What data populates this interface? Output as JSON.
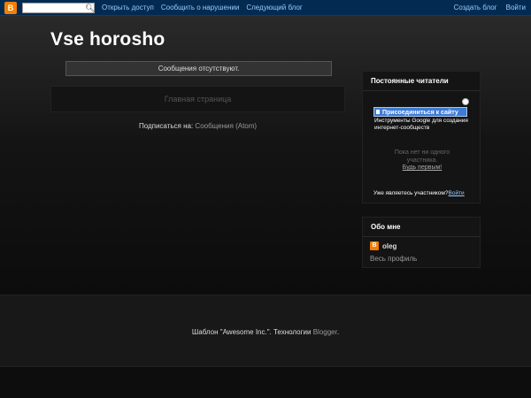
{
  "navbar": {
    "logo_letter": "B",
    "search_placeholder": "",
    "links": [
      "Открыть доступ",
      "Сообщить о нарушении",
      "Следующий блог"
    ],
    "right_links": [
      "Создать блог",
      "Войти"
    ]
  },
  "blog": {
    "title": "Vse horosho",
    "no_posts": "Сообщения отсутствуют.",
    "home_link": "Главная страница",
    "subscribe_prefix": "Подписаться на:",
    "subscribe_link": "Сообщения (Atom)"
  },
  "followers_widget": {
    "title": "Постоянные читатели",
    "join_button": "Присоединиться к сайту",
    "google_tools": "Инструменты Google для создания интернет-сообществ",
    "no_members": "Пока нет ни одного участника.",
    "be_first": "Будь первым!",
    "already_member": "Уже являетесь участником?",
    "login": "Войти"
  },
  "about_widget": {
    "title": "Обо мне",
    "avatar_letter": "B",
    "author_name": "oleg",
    "full_profile": "Весь профиль"
  },
  "footer": {
    "text_prefix": "Шаблон \"Awesome Inc.\". Технологии",
    "blogger_link": "Blogger",
    "text_suffix": "."
  },
  "colors": {
    "navbar_bg": "#032b52",
    "link_blue": "#99ccff",
    "blogger_orange": "#f57d00",
    "join_button": "#3d7bd6"
  },
  "icons": {
    "blogger_logo": "blogger-logo-icon",
    "search": "search-icon",
    "widget_popup": "popup-icon"
  }
}
